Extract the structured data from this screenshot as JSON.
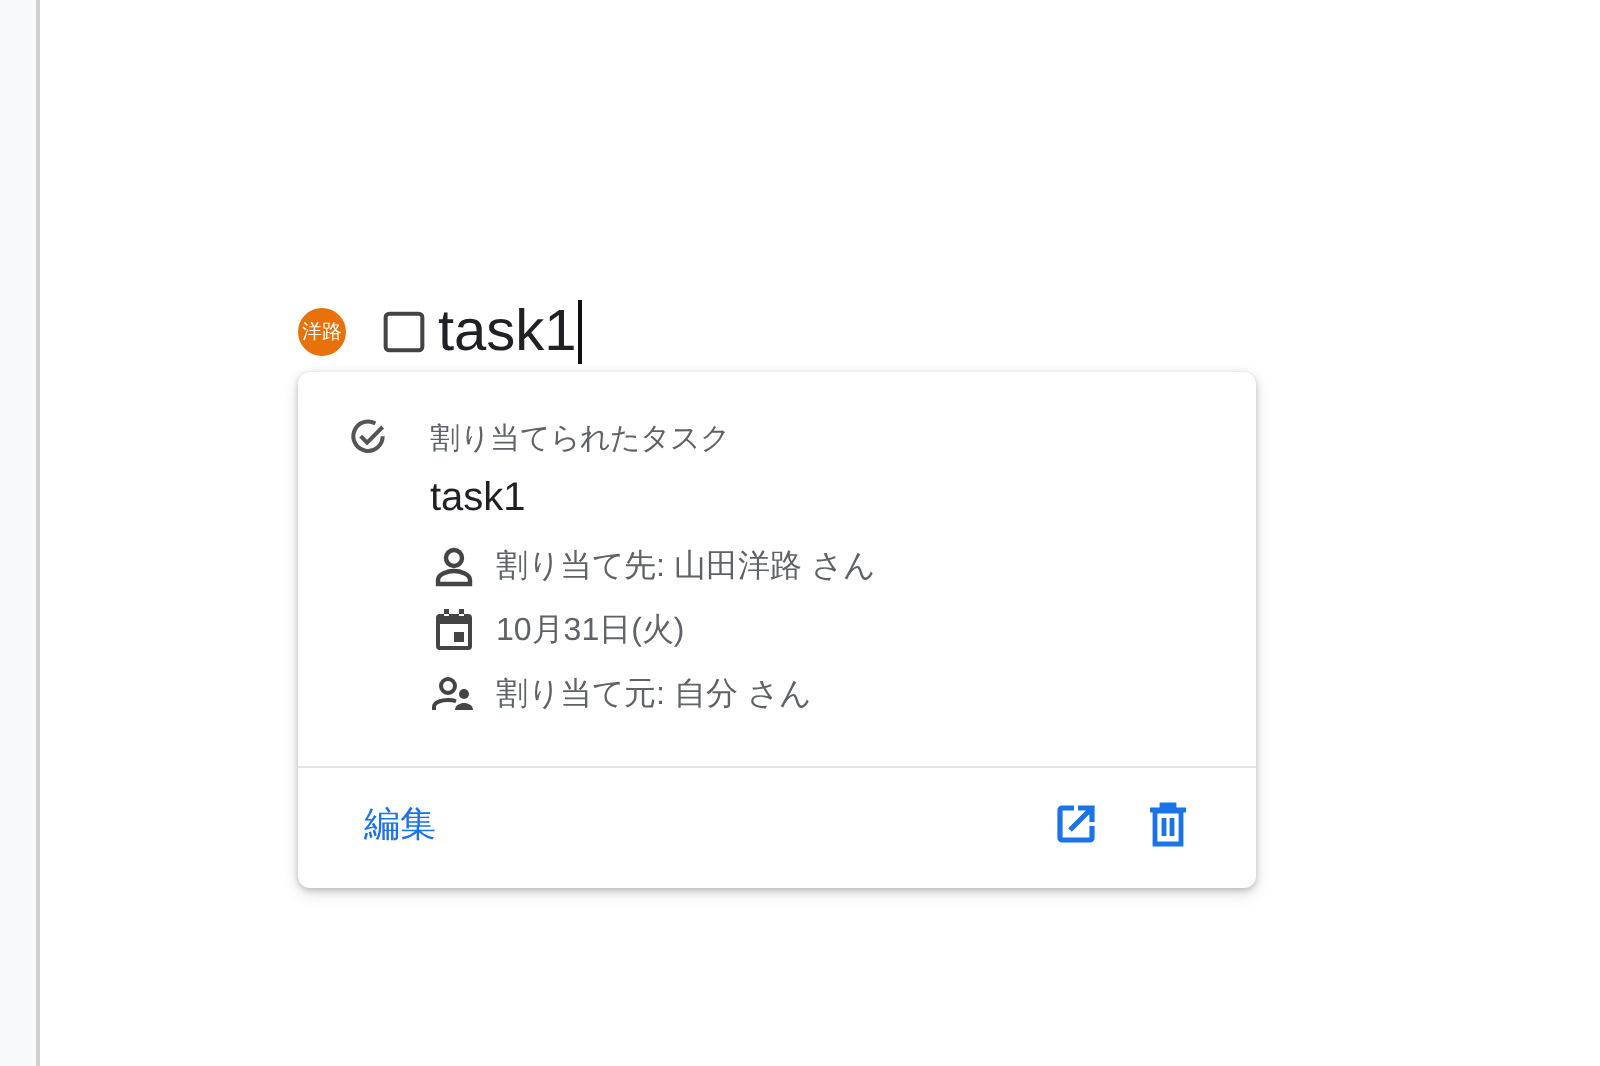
{
  "task_line": {
    "avatar": "洋路",
    "checked": false,
    "text": "task1"
  },
  "card": {
    "header": "割り当てられたタスク",
    "title": "task1",
    "details": [
      {
        "kind": "person",
        "text": "割り当て先: 山田洋路 さん"
      },
      {
        "kind": "date",
        "text": "10月31日(火)"
      },
      {
        "kind": "assigner",
        "text": "割り当て元: 自分 さん"
      }
    ],
    "edit": "編集",
    "actions": [
      {
        "kind": "open"
      },
      {
        "kind": "delete"
      }
    ]
  }
}
